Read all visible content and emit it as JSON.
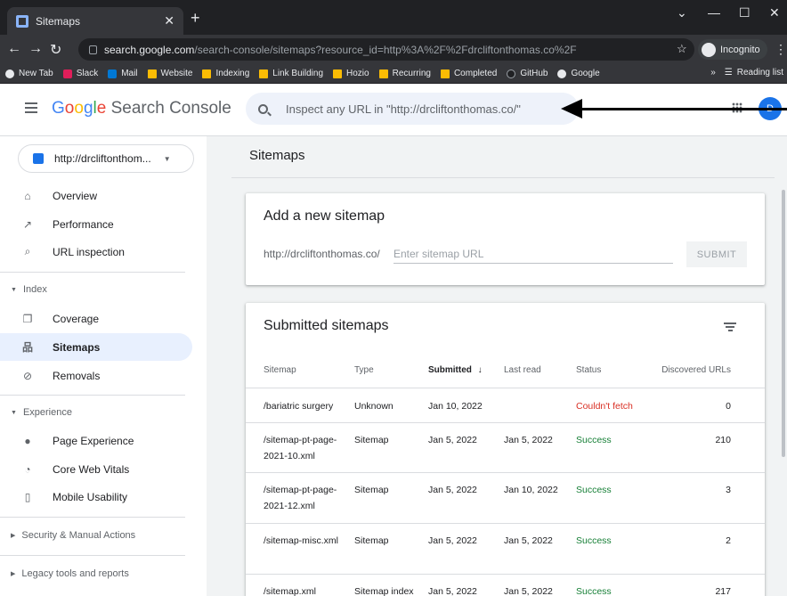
{
  "browser": {
    "tab_title": "Sitemaps",
    "url_host": "search.google.com",
    "url_path": "/search-console/sitemaps?resource_id=http%3A%2F%2Fdrcliftonthomas.co%2F",
    "incognito_label": "Incognito",
    "bookmarks": [
      "New Tab",
      "Slack",
      "Mail",
      "Website",
      "Indexing",
      "Link Building",
      "Hozio",
      "Recurring",
      "Completed",
      "GitHub",
      "Google"
    ],
    "reading_list": "Reading list"
  },
  "header": {
    "logo_google": "Google",
    "logo_suffix": "Search Console",
    "search_placeholder": "Inspect any URL in \"http://drcliftonthomas.co/\"",
    "avatar_initials": "D"
  },
  "sidebar": {
    "property": "http://drcliftonthom...",
    "items": {
      "overview": "Overview",
      "performance": "Performance",
      "url_inspection": "URL inspection",
      "index_section": "Index",
      "coverage": "Coverage",
      "sitemaps": "Sitemaps",
      "removals": "Removals",
      "experience_section": "Experience",
      "page_experience": "Page Experience",
      "core_web_vitals": "Core Web Vitals",
      "mobile_usability": "Mobile Usability",
      "security_section": "Security & Manual Actions",
      "legacy_section": "Legacy tools and reports"
    }
  },
  "main": {
    "page_title": "Sitemaps",
    "add": {
      "heading": "Add a new sitemap",
      "prefix": "http://drcliftonthomas.co/",
      "placeholder": "Enter sitemap URL",
      "submit": "SUBMIT"
    },
    "submitted": {
      "heading": "Submitted sitemaps",
      "columns": {
        "sitemap": "Sitemap",
        "type": "Type",
        "submitted": "Submitted",
        "last_read": "Last read",
        "status": "Status",
        "discovered": "Discovered URLs"
      },
      "rows": [
        {
          "sitemap": "/bariatric surgery",
          "type": "Unknown",
          "submitted": "Jan 10, 2022",
          "last_read": "",
          "status": "Couldn't fetch",
          "discovered": "0"
        },
        {
          "sitemap": "/sitemap-pt-page-2021-10.xml",
          "type": "Sitemap",
          "submitted": "Jan 5, 2022",
          "last_read": "Jan 5, 2022",
          "status": "Success",
          "discovered": "210"
        },
        {
          "sitemap": "/sitemap-pt-page-2021-12.xml",
          "type": "Sitemap",
          "submitted": "Jan 5, 2022",
          "last_read": "Jan 10, 2022",
          "status": "Success",
          "discovered": "3"
        },
        {
          "sitemap": "/sitemap-misc.xml",
          "type": "Sitemap",
          "submitted": "Jan 5, 2022",
          "last_read": "Jan 5, 2022",
          "status": "Success",
          "discovered": "2"
        },
        {
          "sitemap": "/sitemap.xml",
          "type": "Sitemap index",
          "submitted": "Jan 5, 2022",
          "last_read": "Jan 5, 2022",
          "status": "Success",
          "discovered": "217"
        }
      ]
    }
  },
  "colors": {
    "accent": "#1a73e8",
    "success": "#188038",
    "error": "#d93025",
    "active_nav": "#e8f0fe"
  }
}
